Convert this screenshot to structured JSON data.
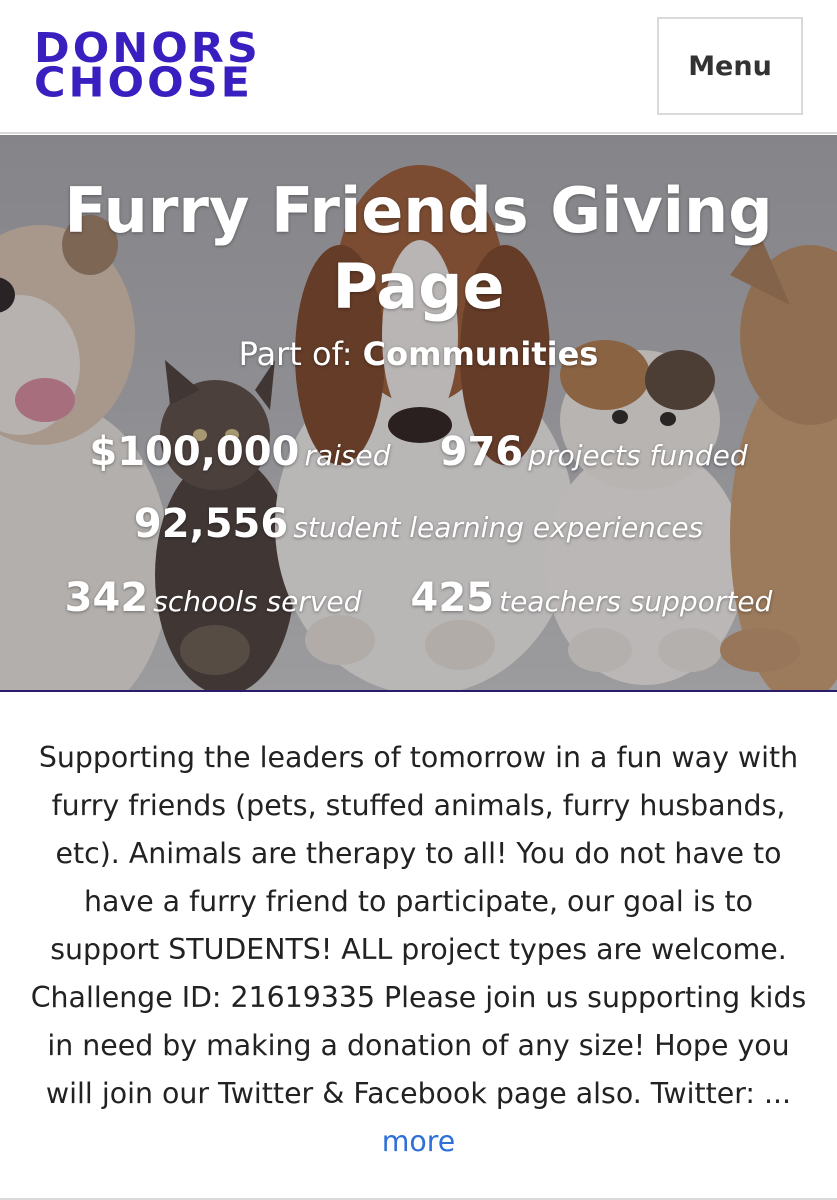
{
  "header": {
    "logo_line1": "DONORS",
    "logo_line2": "CHOOSE",
    "menu_label": "Menu"
  },
  "hero": {
    "title": "Furry Friends Giving Page",
    "part_of_prefix": "Part of:",
    "part_of_name": "Communities",
    "stats": {
      "raised_value": "$100,000",
      "raised_label": "raised",
      "projects_value": "976",
      "projects_label": "projects funded",
      "experiences_value": "92,556",
      "experiences_label": "student learning experiences",
      "schools_value": "342",
      "schools_label": "schools served",
      "teachers_value": "425",
      "teachers_label": "teachers supported"
    }
  },
  "description": {
    "text": "Supporting the leaders of tomorrow in a fun way with furry friends (pets, stuffed animals, furry husbands, etc). Animals are therapy to all! You do not have to have a furry friend to participate, our goal is to support STUDENTS! ALL project types are welcome. Challenge ID: 21619335 Please join us supporting kids in need by making a donation of any size! Hope you will join our Twitter & Facebook page also. Twitter: ...",
    "more_label": "more"
  },
  "colors": {
    "brand": "#3a1fc0",
    "link": "#2f6fd8",
    "border": "#d9d9d9"
  }
}
